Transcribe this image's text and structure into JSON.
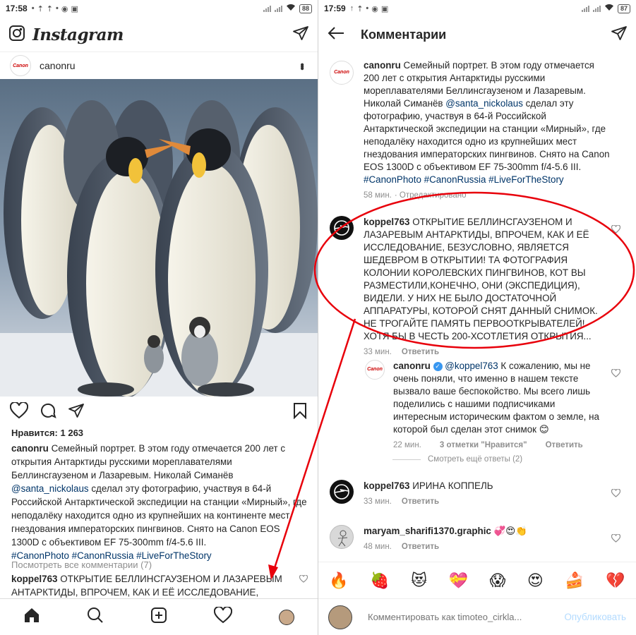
{
  "left": {
    "status": {
      "time": "17:58",
      "battery": "88"
    },
    "app_title": "Instagram",
    "post": {
      "username": "canonru",
      "avatar_text": "Canon",
      "likes": "Нравится: 1 263",
      "caption_user": "canonru",
      "caption_text_1": "Семейный портрет. В этом году отмечается 200 лет с открытия Антарктиды русскими мореплавателями Беллинсгаузеном и Лазаревым. Николай Симанёв ",
      "caption_mention": "@santa_nickolaus",
      "caption_text_2": " сделал эту фотографию, участвуя в 64-й Российской Антарктической экспедиции на станции «Мирный», где неподалёку находится одно из крупнейших на континенте мест гнездования императорских пингвинов. Снято на Canon EOS 1300D с объективом EF 75-300mm f/4-5.6 III.",
      "caption_tags": "#CanonPhoto #CanonRussia #LiveForTheStory",
      "view_all": "Посмотреть все комментарии (7)",
      "preview_user": "koppel763",
      "preview_text": " ОТКРЫТИЕ БЕЛЛИНСГАУЗЕНОМ И ЛАЗАРЕВЫМ АНТАРКТИДЫ, ВПРОЧЕМ, КАК И ЕЁ ИССЛЕДОВАНИЕ,"
    }
  },
  "right": {
    "status": {
      "time": "17:59",
      "battery": "87"
    },
    "title": "Комментарии",
    "caption": {
      "user": "canonru",
      "avatar_text": "Canon",
      "text_1": " Семейный портрет. В этом году отмечается 200 лет с открытия Антарктиды русскими мореплавателями Беллинсгаузеном и Лазаревым. Николай Симанёв ",
      "mention": "@santa_nickolaus",
      "text_2": " сделал эту фотографию, участвуя в 64-й Российской Антарктической экспедиции на станции «Мирный», где неподалёку находится одно из крупнейших мест гнездования императорских пингвинов. Снято на Canon EOS 1300D с объективом EF 75-300mm f/4-5.6 III.",
      "tags": "#CanonPhoto #CanonRussia #LiveForTheStory",
      "time": "58 мин.",
      "edited": "· Отредактировано"
    },
    "comment1": {
      "user": "koppel763",
      "text": " ОТКРЫТИЕ БЕЛЛИНСГАУЗЕНОМ И ЛАЗАРЕВЫМ АНТАРКТИДЫ, ВПРОЧЕМ, КАК И ЕЁ ИССЛЕДОВАНИЕ, БЕЗУСЛОВНО, ЯВЛЯЕТСЯ ШЕДЕВРОМ В ОТКРЫТИИ! ТА ФОТОГРАФИЯ КОЛОНИИ КОРОЛЕВСКИХ ПИНГВИНОВ, КОТ ВЫ РАЗМЕСТИЛИ,КОНЕЧНО, ОНИ (ЭКСПЕДИЦИЯ), ВИДЕЛИ. У НИХ НЕ БЫЛО ДОСТАТОЧНОЙ АППАРАТУРЫ, КОТОРОЙ СНЯТ ДАННЫЙ СНИМОК. НЕ ТРОГАЙТЕ ПАМЯТЬ ПЕРВООТКРЫВАТЕЛЕЙ! ХОТЯ БЫ В ЧЕСТЬ 200-ХСОТЛЕТИЯ ОТКРЫТИЯ...",
      "time": "33 мин.",
      "reply": "Ответить"
    },
    "reply1": {
      "user": "canonru",
      "avatar_text": "Canon",
      "mention": "@koppel763",
      "text": " К сожалению, мы не очень поняли, что именно в нашем тексте вызвало ваше беспокойство. Мы всего лишь поделились с нашими подписчиками интересным историческим фактом о земле, на которой был сделан этот снимок 😊",
      "time": "22 мин.",
      "likes": "3 отметки \"Нравится\"",
      "reply": "Ответить"
    },
    "more_replies": "Смотреть ещё ответы (2)",
    "comment2": {
      "user": "koppel763",
      "text": " ИРИНА КОППЕЛЬ",
      "time": "33 мин.",
      "reply": "Ответить"
    },
    "comment3": {
      "user": "maryam_sharifi1370.graphic",
      "text": " 💞😍👏",
      "time": "48 мин.",
      "reply": "Ответить"
    },
    "emojis": [
      "🔥",
      "🍓",
      "😻",
      "💝",
      "😱",
      "😍",
      "🍰",
      "💔"
    ],
    "input_placeholder": "Комментировать как timoteo_cirkla...",
    "post_label": "Опубликовать"
  },
  "accent_colors": {
    "link": "#003569",
    "annotation": "#e8000b",
    "post_disabled": "#b3dbff"
  }
}
